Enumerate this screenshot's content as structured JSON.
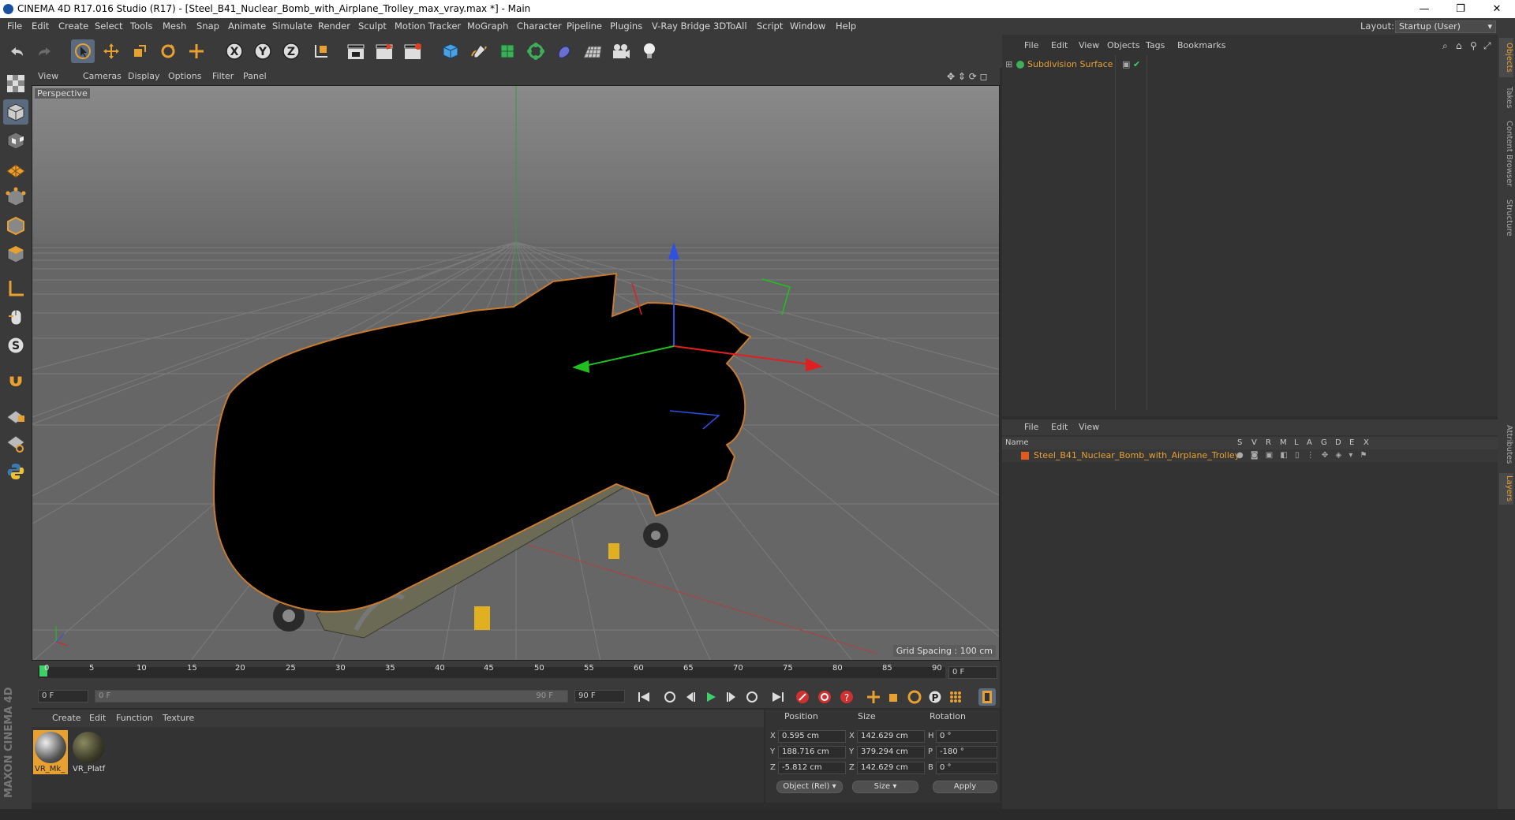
{
  "window": {
    "title": "CINEMA 4D R17.016 Studio (R17) - [Steel_B41_Nuclear_Bomb_with_Airplane_Trolley_max_vray.max *] - Main",
    "minimize": "—",
    "maximize": "❐",
    "close": "✕"
  },
  "menubar": {
    "items": [
      "File",
      "Edit",
      "Create",
      "Select",
      "Tools",
      "Mesh",
      "Snap",
      "Animate",
      "Simulate",
      "Render",
      "Sculpt",
      "Motion Tracker",
      "MoGraph",
      "Character",
      "Pipeline",
      "Plugins",
      "V-Ray Bridge",
      "3DToAll",
      "Script",
      "Window",
      "Help"
    ],
    "layout_label": "Layout:",
    "layout_value": "Startup (User)"
  },
  "viewport": {
    "menu": [
      "View",
      "Cameras",
      "Display",
      "Options",
      "Filter",
      "Panel"
    ],
    "label": "Perspective",
    "grid_spacing": "Grid Spacing : 100 cm"
  },
  "timeline": {
    "ticks": [
      "0",
      "5",
      "10",
      "15",
      "20",
      "25",
      "30",
      "35",
      "40",
      "45",
      "50",
      "55",
      "60",
      "65",
      "70",
      "75",
      "80",
      "85",
      "90"
    ],
    "current_frame": "0 F",
    "start_frame": "0 F",
    "range_start": "0 F",
    "range_end": "90 F",
    "end_frame": "90 F"
  },
  "materials": {
    "menu": [
      "Create",
      "Edit",
      "Function",
      "Texture"
    ],
    "items": [
      {
        "name": "VR_Mk_"
      },
      {
        "name": "VR_Platf"
      }
    ]
  },
  "coords": {
    "headers": {
      "position": "Position",
      "size": "Size",
      "rotation": "Rotation"
    },
    "rows": [
      {
        "axis": "X",
        "pos": "0.595 cm",
        "size_axis": "X",
        "size": "142.629 cm",
        "rot_axis": "H",
        "rot": "0 °"
      },
      {
        "axis": "Y",
        "pos": "188.716 cm",
        "size_axis": "Y",
        "size": "379.294 cm",
        "rot_axis": "P",
        "rot": "-180 °"
      },
      {
        "axis": "Z",
        "pos": "-5.812 cm",
        "size_axis": "Z",
        "size": "142.629 cm",
        "rot_axis": "B",
        "rot": "0 °"
      }
    ],
    "mode": "Object (Rel)",
    "size_mode": "Size",
    "apply": "Apply"
  },
  "objects": {
    "menu": [
      "File",
      "Edit",
      "View",
      "Objects",
      "Tags",
      "Bookmarks"
    ],
    "row": "Subdivision Surface"
  },
  "layers": {
    "menu": [
      "File",
      "Edit",
      "View"
    ],
    "headers": [
      "Name",
      "S",
      "V",
      "R",
      "M",
      "L",
      "A",
      "G",
      "D",
      "E",
      "X"
    ],
    "row": "Steel_B41_Nuclear_Bomb_with_Airplane_Trolley"
  },
  "right_tabs": [
    "Objects",
    "Takes",
    "Content Browser",
    "Structure",
    "Attributes",
    "Layers"
  ],
  "brand": "MAXON CINEMA 4D",
  "colors": {
    "accent": "#e8a030",
    "selection": "#5a6b80",
    "panel": "#333333"
  }
}
